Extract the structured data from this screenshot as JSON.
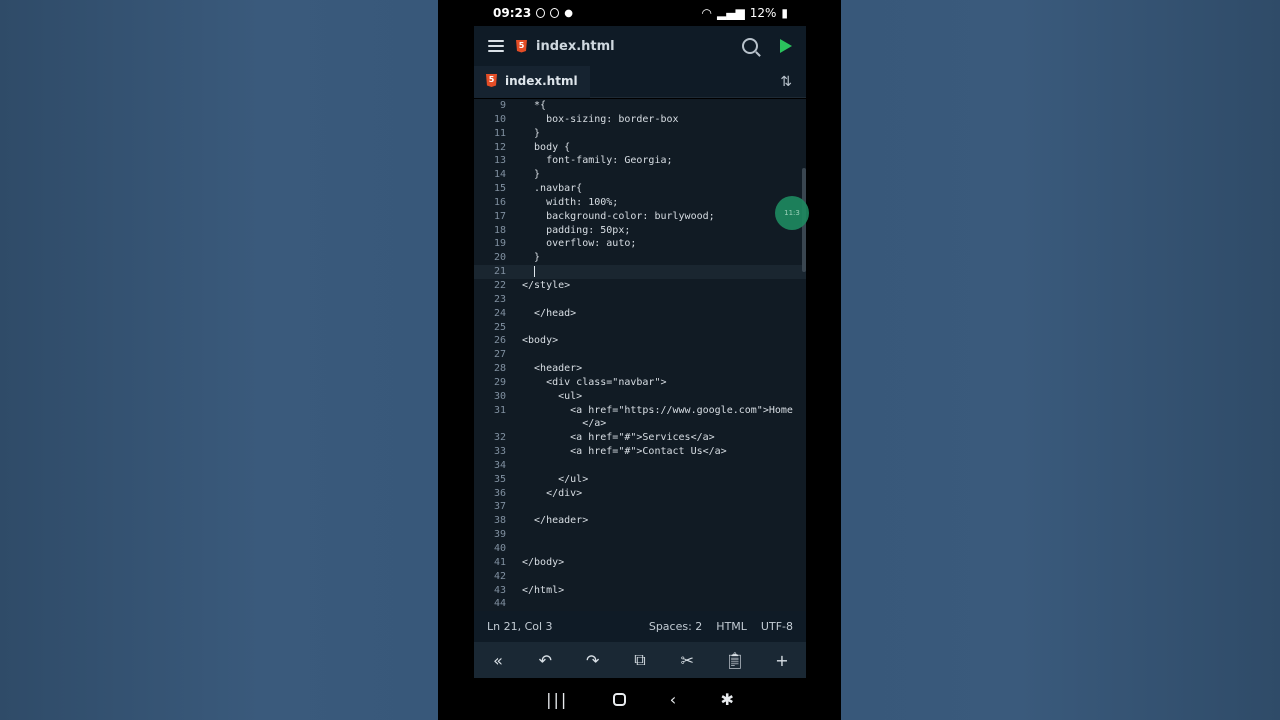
{
  "status_bar": {
    "time": "09:23",
    "battery": "12%"
  },
  "app_bar": {
    "title": "index.html",
    "icons": [
      "menu-icon",
      "html5-icon",
      "search-icon",
      "play-icon"
    ]
  },
  "tab": {
    "label": "index.html"
  },
  "editor": {
    "cursor_line": 21,
    "lines": [
      {
        "n": "9",
        "t": "  *{"
      },
      {
        "n": "10",
        "t": "    box-sizing: border-box"
      },
      {
        "n": "11",
        "t": "  }"
      },
      {
        "n": "12",
        "t": "  body {"
      },
      {
        "n": "13",
        "t": "    font-family: Georgia;"
      },
      {
        "n": "14",
        "t": "  }"
      },
      {
        "n": "15",
        "t": "  .navbar{"
      },
      {
        "n": "16",
        "t": "    width: 100%;"
      },
      {
        "n": "17",
        "t": "    background-color: burlywood;"
      },
      {
        "n": "18",
        "t": "    padding: 50px;"
      },
      {
        "n": "19",
        "t": "    overflow: auto;"
      },
      {
        "n": "20",
        "t": "  }"
      },
      {
        "n": "21",
        "t": "  "
      },
      {
        "n": "22",
        "t": "</style>"
      },
      {
        "n": "23",
        "t": ""
      },
      {
        "n": "24",
        "t": "  </head>"
      },
      {
        "n": "25",
        "t": ""
      },
      {
        "n": "26",
        "t": "<body>"
      },
      {
        "n": "27",
        "t": ""
      },
      {
        "n": "28",
        "t": "  <header>"
      },
      {
        "n": "29",
        "t": "    <div class=\"navbar\">"
      },
      {
        "n": "30",
        "t": "      <ul>"
      },
      {
        "n": "31",
        "t": "        <a href=\"https://www.google.com\">Home"
      },
      {
        "n": "",
        "t": "          </a>"
      },
      {
        "n": "32",
        "t": "        <a href=\"#\">Services</a>"
      },
      {
        "n": "33",
        "t": "        <a href=\"#\">Contact Us</a>"
      },
      {
        "n": "34",
        "t": ""
      },
      {
        "n": "35",
        "t": "      </ul>"
      },
      {
        "n": "36",
        "t": "    </div>"
      },
      {
        "n": "37",
        "t": ""
      },
      {
        "n": "38",
        "t": "  </header>"
      },
      {
        "n": "39",
        "t": ""
      },
      {
        "n": "40",
        "t": ""
      },
      {
        "n": "41",
        "t": "</body>"
      },
      {
        "n": "42",
        "t": ""
      },
      {
        "n": "43",
        "t": "</html>"
      },
      {
        "n": "44",
        "t": ""
      }
    ]
  },
  "float_button": {
    "label": "11:3"
  },
  "info_bar": {
    "position": "Ln 21, Col 3",
    "spaces": "Spaces: 2",
    "language": "HTML",
    "encoding": "UTF-8"
  },
  "toolbar": {
    "icons": [
      "chevron-double-left-icon",
      "undo-icon",
      "redo-icon",
      "copy-icon",
      "cut-icon",
      "paste-icon",
      "plus-icon"
    ]
  },
  "colors": {
    "editor_bg": "#111b24",
    "bar_bg": "#0f1b26",
    "play_green": "#2bc25d",
    "html5_orange": "#e44d26"
  }
}
